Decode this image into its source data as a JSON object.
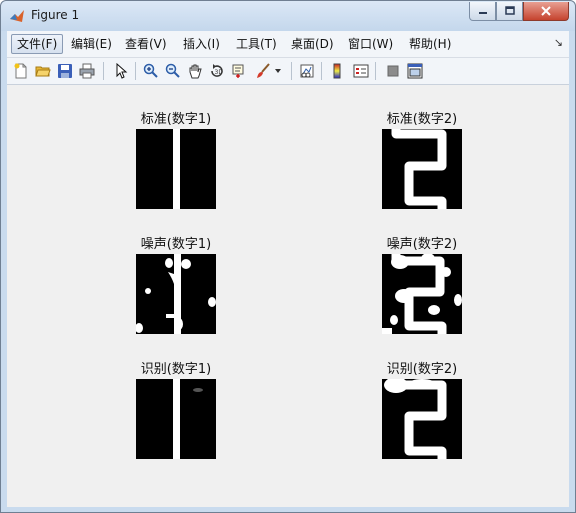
{
  "window": {
    "title": "Figure 1",
    "minimize_icon": "minimize-icon",
    "maximize_icon": "maximize-icon",
    "close_icon": "close-icon"
  },
  "menu": {
    "items": [
      {
        "label": "文件(F)"
      },
      {
        "label": "编辑(E)"
      },
      {
        "label": "查看(V)"
      },
      {
        "label": "插入(I)"
      },
      {
        "label": "工具(T)"
      },
      {
        "label": "桌面(D)"
      },
      {
        "label": "窗口(W)"
      },
      {
        "label": "帮助(H)"
      }
    ],
    "active_index": 0
  },
  "toolbar": {
    "icons": [
      "new-figure-icon",
      "open-file-icon",
      "save-icon",
      "print-icon",
      "pointer-icon",
      "zoom-in-icon",
      "zoom-out-icon",
      "pan-icon",
      "rotate-3d-icon",
      "data-cursor-icon",
      "brush-icon",
      "brush-dropdown-icon",
      "link-plot-icon",
      "colorbar-icon",
      "legend-icon",
      "hide-plot-tools-icon",
      "show-plot-tools-icon"
    ]
  },
  "plots": {
    "std1": {
      "title": "标准(数字1)"
    },
    "std2": {
      "title": "标准(数字2)"
    },
    "noise1": {
      "title": "噪声(数字1)"
    },
    "noise2": {
      "title": "噪声(数字2)"
    },
    "rec1": {
      "title": "识别(数字1)"
    },
    "rec2": {
      "title": "识别(数字2)"
    }
  }
}
